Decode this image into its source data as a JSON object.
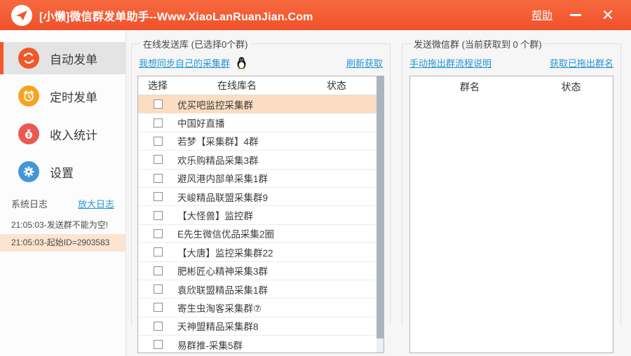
{
  "titlebar": {
    "title": "[小懒]微信群发单助手--Www.XiaoLanRuanJian.Com",
    "help_label": "帮助",
    "close_glyph": "✕"
  },
  "sidebar": {
    "items": [
      {
        "id": "auto-send",
        "label": "自动发单",
        "icon": "refresh-icon",
        "color": "#f2582a",
        "active": true
      },
      {
        "id": "timed-send",
        "label": "定时发单",
        "icon": "alarm-icon",
        "color": "#f6a41f",
        "active": false
      },
      {
        "id": "income-stats",
        "label": "收入统计",
        "icon": "money-bag-icon",
        "color": "#e95a51",
        "active": false
      },
      {
        "id": "settings",
        "label": "设置",
        "icon": "gear-icon",
        "color": "#4596d7",
        "active": false
      }
    ],
    "log": {
      "label": "系统日志",
      "enlarge_link": "放大日志",
      "entries": [
        {
          "text": "21:05:03-发送群不能为空!",
          "highlight": false
        },
        {
          "text": "21:05:03-起始ID=2903583",
          "highlight": true
        }
      ]
    }
  },
  "online_library_panel": {
    "title": "在线发送库 (已选择0个群)",
    "sync_link": "我想同步自己的采集群",
    "refresh_link": "刷新获取",
    "columns": [
      "选择",
      "在线库名",
      "状态"
    ],
    "rows": [
      {
        "name": "优买吧监控采集群",
        "checked": false,
        "highlight": true,
        "status": ""
      },
      {
        "name": "中国好直播",
        "checked": false,
        "highlight": false,
        "status": ""
      },
      {
        "name": "若梦【采集群】4群",
        "checked": false,
        "highlight": false,
        "status": ""
      },
      {
        "name": "欢乐购精品采集3群",
        "checked": false,
        "highlight": false,
        "status": ""
      },
      {
        "name": "避风港内部单采集1群",
        "checked": false,
        "highlight": false,
        "status": ""
      },
      {
        "name": "天峻精品联盟采集群9",
        "checked": false,
        "highlight": false,
        "status": ""
      },
      {
        "name": "【大怪兽】监控群",
        "checked": false,
        "highlight": false,
        "status": ""
      },
      {
        "name": "E先生微信优品采集2圈",
        "checked": false,
        "highlight": false,
        "status": ""
      },
      {
        "name": "【大唐】监控采集群22",
        "checked": false,
        "highlight": false,
        "status": ""
      },
      {
        "name": "肥彬匠心精神采集3群",
        "checked": false,
        "highlight": false,
        "status": ""
      },
      {
        "name": "袁欣联盟精品采集1群",
        "checked": false,
        "highlight": false,
        "status": ""
      },
      {
        "name": "寄生虫淘客采集群⑦",
        "checked": false,
        "highlight": false,
        "status": ""
      },
      {
        "name": "天神盟精品采集群8",
        "checked": false,
        "highlight": false,
        "status": ""
      },
      {
        "name": "易群推-采集5群",
        "checked": false,
        "highlight": false,
        "status": ""
      }
    ]
  },
  "wechat_group_panel": {
    "title": "发送微信群 (当前获取到 0 个群)",
    "guide_link": "手动拖出群流程说明",
    "fetch_link": "获取已拖出群名",
    "columns": [
      "群名",
      "状态"
    ],
    "rows": []
  },
  "colors": {
    "titlebar_orange": "#f1512a",
    "accent_orange": "#f4572a",
    "link_blue": "#2694d4",
    "row_highlight": "#fbddc1",
    "log_highlight": "#fde4d0"
  }
}
